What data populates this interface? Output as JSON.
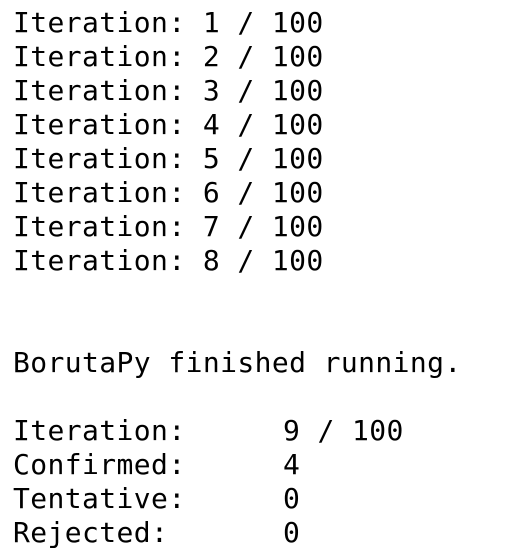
{
  "progress_lines": [
    "Iteration: 1 / 100",
    "Iteration: 2 / 100",
    "Iteration: 3 / 100",
    "Iteration: 4 / 100",
    "Iteration: 5 / 100",
    "Iteration: 6 / 100",
    "Iteration: 7 / 100",
    "Iteration: 8 / 100"
  ],
  "finished_message": "BorutaPy finished running.",
  "summary": [
    {
      "label": "Iteration:",
      "value": "9 / 100"
    },
    {
      "label": "Confirmed:",
      "value": "4"
    },
    {
      "label": "Tentative:",
      "value": "0"
    },
    {
      "label": "Rejected:",
      "value": "0"
    }
  ]
}
